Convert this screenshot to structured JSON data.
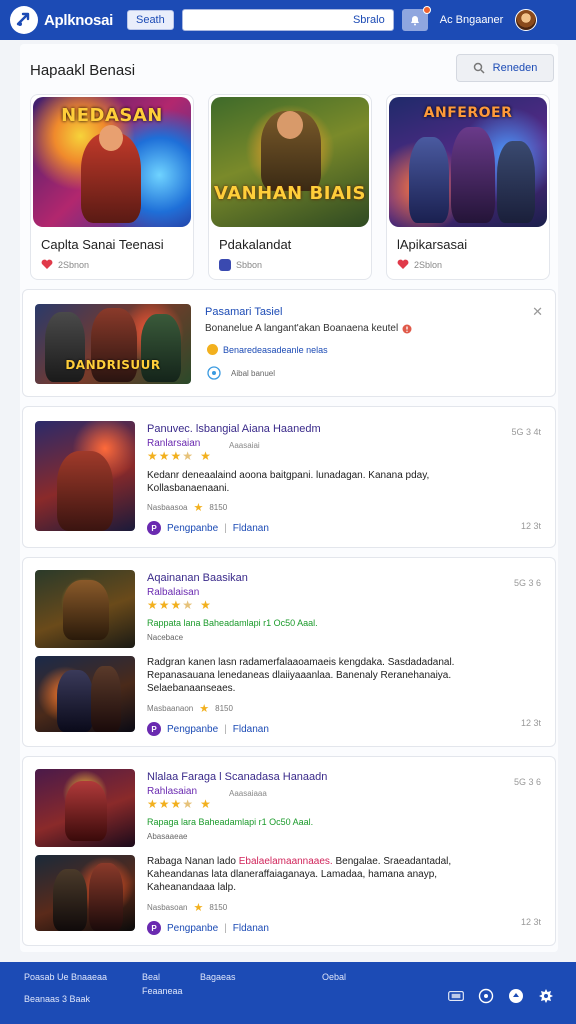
{
  "topbar": {
    "app_title": "Aplknosai",
    "search_button": "Seath",
    "search_placeholder": "Sbralo",
    "user_name": "Ac Bngaaner"
  },
  "main": {
    "section_title": "Hapaakl Benasi",
    "header_button": "Reneden"
  },
  "featured": [
    {
      "title": "Caplta Sanai Teenasi",
      "meta": "2Sbnon",
      "art_label": "NEDASAN"
    },
    {
      "title": "Pdakalandat",
      "meta": "Sbbon",
      "art_label": "VANHAN BIAIS"
    },
    {
      "title": "lApikarsasai",
      "meta": "2Sblon",
      "art_label": "ANFEROER"
    }
  ],
  "promo": {
    "title": "Pasamari Tasiel",
    "desc": "Bonanelue A langant'akan Boanaena keutel",
    "link": "Benaredeasadeanle nelas",
    "sub": "Aibal banuel",
    "art_label": "DANDRISUUR"
  },
  "listings": [
    {
      "title": "Panuvec. lsbangial Aiana Haanedm",
      "category": "Ranlarsaian",
      "sub": "Aaasaiai",
      "rating_count": "",
      "desc_pre": "Kedanr deneaalaind aoona baitgpani. lunadagan. Kanana pday,",
      "desc_hl": "",
      "desc_post": "Kollasbanaenaani.",
      "meta": "Nasbaasoa",
      "meta_count": "8150",
      "footer": "Pengpanbe",
      "footer_alt": "Fldanan",
      "size": "5G 3 4t",
      "time": "12 3t"
    },
    {
      "title": "Aqainanan Baasikan",
      "category": "Ralbalaisan",
      "sub": "",
      "rating_count": "",
      "green": "Rappata lana Baheadamlapi r1 Oc50 Aaal.",
      "gray": "Nacebace",
      "desc_pre": "Radgran kanen lasn ",
      "desc_hl": "",
      "desc_post": "radamerfalaaoamaeis kengdaka. Sasdadadanal. Repanasauana lenedaneas dlaiiyaaanlaa. Banenaly Reranehanaiya. Selaebanaanseaes.",
      "meta": "Masbaanaon",
      "meta_count": "8150",
      "footer": "Pengpanbe",
      "footer_alt": "Fldanan",
      "size": "5G 3 6",
      "time": "12 3t"
    },
    {
      "title": "Nlalaa Faraga l Scanadasa Hanaadn",
      "category": "Rahlasaian",
      "sub": "Aaasaiaaa",
      "rating_count": "",
      "green": "Rapaga lara Baheadamlapi r1 Oc50 Aaal.",
      "gray": "Abasaaeae",
      "desc_pre": "Rabaga Nanan lado ",
      "desc_hl": "Ebalaelamaannaaes.",
      "desc_post": " Bengalae. Sraeadantadal, Kaheandanas lata dlaneraffaiaganaya. Lamadaa, hamana anayp, Kaheanandaaa lalp.",
      "meta": "Nasbasoan",
      "meta_count": "8150",
      "footer": "Pengpanbe",
      "footer_alt": "Fldanan",
      "size": "5G 3 6",
      "time": "12 3t"
    }
  ],
  "footer": {
    "col1": [
      "Poasab Ue Bnaaeaa",
      "Beanaas 3 Baak"
    ],
    "col2": [
      "Beal",
      "Feaaneaa"
    ],
    "col3": [
      "Bagaeas"
    ],
    "col4": [
      "Oebal"
    ]
  },
  "colors": {
    "brand_blue": "#1c4bb5",
    "star": "#f2b01e",
    "green": "#1a9a2a",
    "purple": "#6a2ab0"
  }
}
